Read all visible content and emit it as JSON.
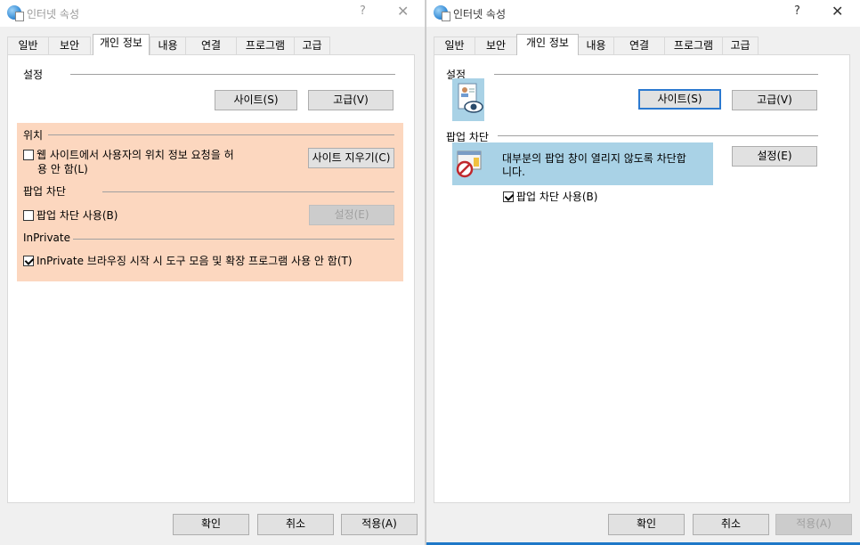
{
  "left_dialog": {
    "title": "인터넷 속성",
    "help": "?",
    "close": "✕",
    "tabs": [
      "일반",
      "보안",
      "개인 정보",
      "내용",
      "연결",
      "프로그램",
      "고급"
    ],
    "active_tab": "개인 정보",
    "settings_label": "설정",
    "sites_button": "사이트(S)",
    "advanced_button": "고급(V)",
    "location": {
      "label": "위치",
      "checkbox_line1": "웹 사이트에서 사용자의 위치 정보 요청을 허",
      "checkbox_line2": "용 안 함(L)",
      "checked": false,
      "clear_sites_button": "사이트 지우기(C)"
    },
    "popup": {
      "label": "팝업 차단",
      "checkbox": "팝업 차단 사용(B)",
      "checked": false,
      "settings_button": "설정(E)"
    },
    "inprivate": {
      "label": "InPrivate",
      "checkbox": "InPrivate 브라우징 시작 시 도구 모음 및 확장 프로그램 사용 안 함(T)",
      "checked": true
    },
    "ok_button": "확인",
    "cancel_button": "취소",
    "apply_button": "적용(A)"
  },
  "right_dialog": {
    "title": "인터넷 속성",
    "help": "?",
    "close": "✕",
    "tabs": [
      "일반",
      "보안",
      "개인 정보",
      "내용",
      "연결",
      "프로그램",
      "고급"
    ],
    "active_tab": "개인 정보",
    "settings_label": "설정",
    "sites_button": "사이트(S)",
    "advanced_button": "고급(V)",
    "popup": {
      "label": "팝업 차단",
      "description_line1": "대부분의 팝업 창이 열리지 않도록 차단합",
      "description_line2": "니다.",
      "settings_button": "설정(E)",
      "checkbox": "팝업 차단 사용(B)",
      "checked": true
    },
    "ok_button": "확인",
    "cancel_button": "취소",
    "apply_button": "적용(A)"
  },
  "colors": {
    "highlight_orange": "#fcd7bf",
    "highlight_blue": "#a9d2e6",
    "focus_border": "#2b79d0"
  }
}
